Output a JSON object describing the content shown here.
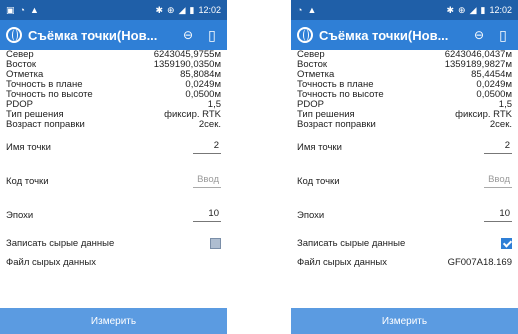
{
  "left": {
    "status": {
      "time": "12:02"
    },
    "app_title": "Съёмка точки(Нов...",
    "readouts": [
      {
        "label": "Север",
        "value": "6243045,9755м"
      },
      {
        "label": "Восток",
        "value": "1359190,0350м"
      },
      {
        "label": "Отметка",
        "value": "85,8084м"
      },
      {
        "label": "Точность в плане",
        "value": "0,0249м"
      },
      {
        "label": "Точность по высоте",
        "value": "0,0500м"
      },
      {
        "label": "PDOP",
        "value": "1,5"
      },
      {
        "label": "Тип решения",
        "value": "фиксир. RTK"
      },
      {
        "label": "Возраст поправки",
        "value": "2сек."
      }
    ],
    "point_name": {
      "label": "Имя точки",
      "value": "2"
    },
    "point_code": {
      "label": "Код точки",
      "placeholder": "Ввод"
    },
    "epochs": {
      "label": "Эпохи",
      "value": "10"
    },
    "raw_data": {
      "label": "Записать сырые данные",
      "checked": false
    },
    "raw_file": {
      "label": "Файл сырых данных",
      "value": ""
    },
    "measure_button": "Измерить"
  },
  "right": {
    "status": {
      "time": "12:02"
    },
    "app_title": "Съёмка точки(Нов...",
    "readouts": [
      {
        "label": "Север",
        "value": "6243046,0437м"
      },
      {
        "label": "Восток",
        "value": "1359189,9827м"
      },
      {
        "label": "Отметка",
        "value": "85,4454м"
      },
      {
        "label": "Точность в плане",
        "value": "0,0249м"
      },
      {
        "label": "Точность по высоте",
        "value": "0,0500м"
      },
      {
        "label": "PDOP",
        "value": "1,5"
      },
      {
        "label": "Тип решения",
        "value": "фиксир. RTK"
      },
      {
        "label": "Возраст поправки",
        "value": "2сек."
      }
    ],
    "point_name": {
      "label": "Имя точки",
      "value": "2"
    },
    "point_code": {
      "label": "Код точки",
      "placeholder": "Ввод"
    },
    "epochs": {
      "label": "Эпохи",
      "value": "10"
    },
    "raw_data": {
      "label": "Записать сырые данные",
      "checked": true
    },
    "raw_file": {
      "label": "Файл сырых данных",
      "value": "GF007A18.169"
    },
    "measure_button": "Измерить"
  }
}
